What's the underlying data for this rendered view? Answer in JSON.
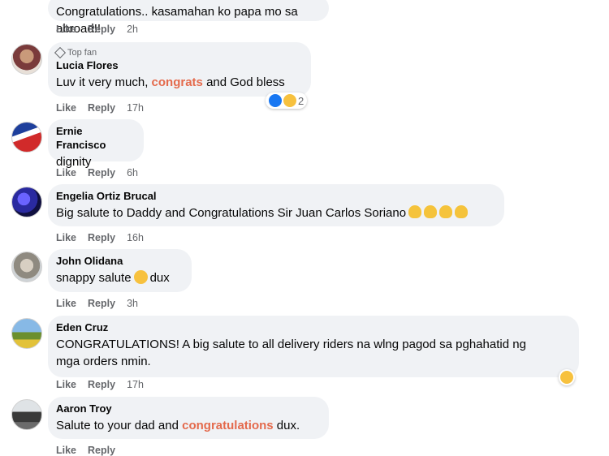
{
  "comments": [
    {
      "name": "",
      "text": "Congratulations.. kasamahan ko papa mo sa abroad!!",
      "like": "Like",
      "reply": "Reply",
      "time": "2h"
    },
    {
      "badge": "Top fan",
      "name": "Lucia Flores",
      "text_pre": "Luv it very much, ",
      "text_hl": "congrats",
      "text_post": " and God bless",
      "reaction_count": "2",
      "like": "Like",
      "reply": "Reply",
      "time": "17h"
    },
    {
      "name": "Ernie Francisco",
      "text": "dignity",
      "like": "Like",
      "reply": "Reply",
      "time": "6h"
    },
    {
      "name": "Engelia Ortiz Brucal",
      "text": "Big salute to Daddy and Congratulations Sir Juan Carlos Soriano",
      "like": "Like",
      "reply": "Reply",
      "time": "16h"
    },
    {
      "name": "John Olidana",
      "text_pre": "snappy salute",
      "text_post": "dux",
      "like": "Like",
      "reply": "Reply",
      "time": "3h"
    },
    {
      "name": "Eden Cruz",
      "text_line1": "CONGRATULATIONS! A big salute to all delivery riders na wlng pagod sa pghahatid ng",
      "text_line2": "mga orders nmin.",
      "like": "Like",
      "reply": "Reply",
      "time": "17h"
    },
    {
      "name": "Aaron Troy",
      "text_pre": "Salute to your dad and ",
      "text_hl": "congratulations",
      "text_post": " dux.",
      "like": "Like",
      "reply": "Reply",
      "time": ""
    }
  ],
  "colors": {
    "highlight": "#e46a4c",
    "bubble": "#f0f2f5",
    "meta": "#65676b",
    "like": "#1877f2"
  }
}
